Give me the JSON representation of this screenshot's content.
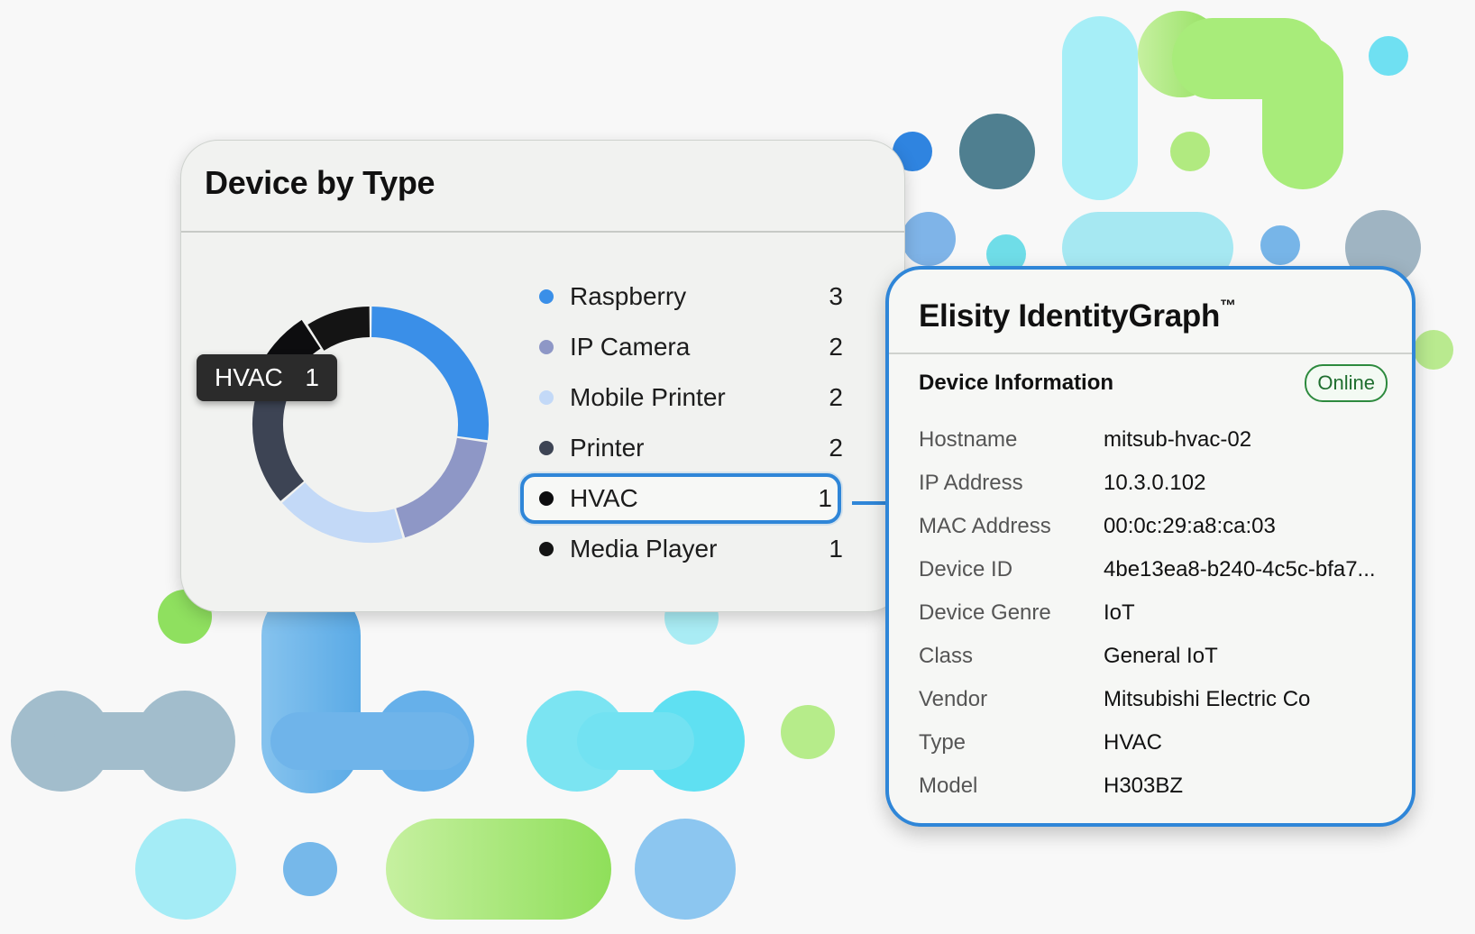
{
  "device_by_type": {
    "title": "Device by Type",
    "tooltip": {
      "label": "HVAC",
      "value": "1"
    },
    "items": [
      {
        "label": "Raspberry",
        "count": "3",
        "color": "#3a8fe8"
      },
      {
        "label": "IP Camera",
        "count": "2",
        "color": "#8e97c6"
      },
      {
        "label": "Mobile Printer",
        "count": "2",
        "color": "#c3d9f7"
      },
      {
        "label": "Printer",
        "count": "2",
        "color": "#3d4454"
      },
      {
        "label": "HVAC",
        "count": "1",
        "color": "#0d0d0f"
      },
      {
        "label": "Media Player",
        "count": "1",
        "color": "#141414"
      }
    ],
    "selected": "HVAC"
  },
  "identity_graph": {
    "title": "Elisity IdentityGraph",
    "trademark": "™",
    "section_title": "Device Information",
    "status": "Online",
    "fields": [
      {
        "key": "Hostname",
        "value": "mitsub-hvac-02"
      },
      {
        "key": "IP Address",
        "value": "10.3.0.102"
      },
      {
        "key": "MAC Address",
        "value": "00:0c:29:a8:ca:03"
      },
      {
        "key": "Device ID",
        "value": "4be13ea8-b240-4c5c-bfa7..."
      },
      {
        "key": "Device Genre",
        "value": "IoT"
      },
      {
        "key": "Class",
        "value": "General IoT"
      },
      {
        "key": "Vendor",
        "value": "Mitsubishi Electric Co"
      },
      {
        "key": "Type",
        "value": "HVAC"
      },
      {
        "key": "Model",
        "value": "H303BZ"
      }
    ]
  }
}
